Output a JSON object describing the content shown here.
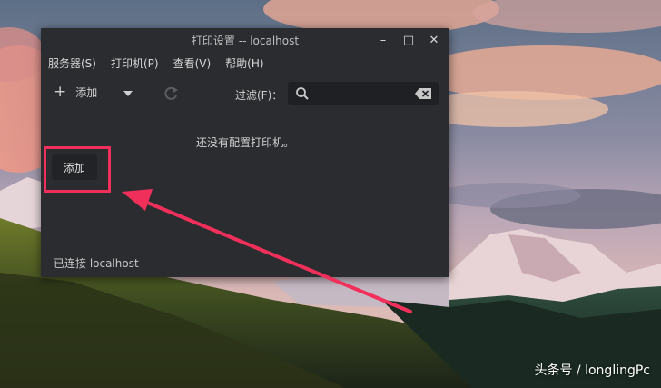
{
  "window": {
    "title": "打印设置 -- localhost",
    "controls": {
      "minimize": "–",
      "maximize": "□",
      "close": "✕"
    }
  },
  "menubar": {
    "items": [
      "服务器(S)",
      "打印机(P)",
      "查看(V)",
      "帮助(H)"
    ]
  },
  "toolbar": {
    "add_label": "添加",
    "filter_label": "过滤(F)：",
    "search_value": "",
    "icons": [
      "plus-icon",
      "chevron-down-icon",
      "refresh-icon",
      "search-icon",
      "clear-icon"
    ]
  },
  "main": {
    "empty_message": "还没有配置打印机。",
    "add_button_label": "添加"
  },
  "status": {
    "text": "已连接 localhost"
  },
  "annotation": {
    "color": "#f0305a"
  },
  "watermark": "头条号 / longlingPc"
}
